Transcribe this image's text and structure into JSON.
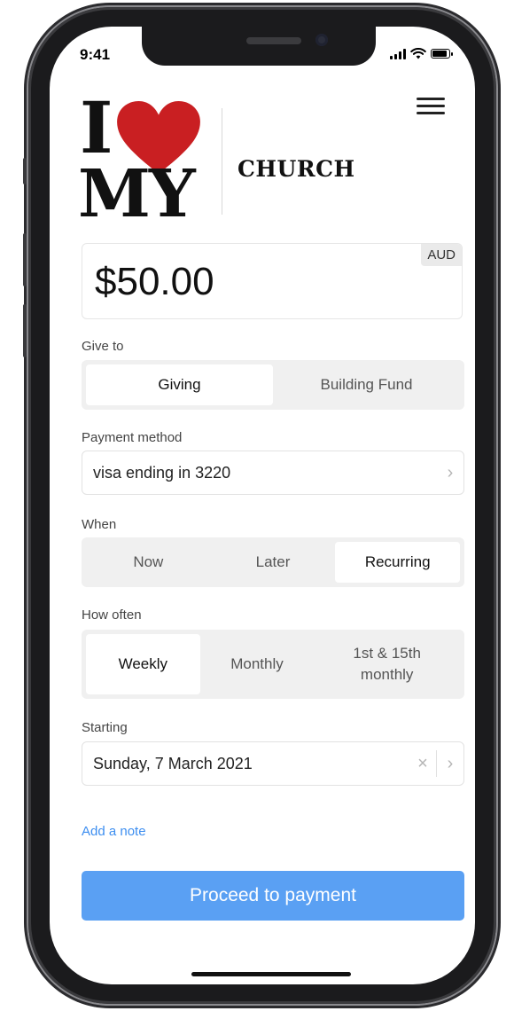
{
  "status_bar": {
    "time": "9:41"
  },
  "logo": {
    "line1": "I",
    "line2": "MY",
    "heart_color": "#c91f22"
  },
  "brand": {
    "name": "CHURCH"
  },
  "amount": {
    "value": "$50.00",
    "currency": "AUD"
  },
  "give_to": {
    "label": "Give to",
    "options": [
      "Giving",
      "Building Fund"
    ],
    "selected": "Giving"
  },
  "payment_method": {
    "label": "Payment method",
    "value": "visa ending in 3220"
  },
  "when": {
    "label": "When",
    "options": [
      "Now",
      "Later",
      "Recurring"
    ],
    "selected": "Recurring"
  },
  "how_often": {
    "label": "How often",
    "options": [
      "Weekly",
      "Monthly",
      "1st & 15th monthly"
    ],
    "selected": "Weekly"
  },
  "starting": {
    "label": "Starting",
    "value": "Sunday, 7 March 2021"
  },
  "add_note": {
    "label": "Add a note"
  },
  "proceed": {
    "label": "Proceed to payment"
  },
  "colors": {
    "accent": "#5aa0f3",
    "link": "#3d8ef0",
    "heart": "#c91f22"
  },
  "icons": {
    "menu": "hamburger-icon",
    "chevron": "chevron-right-icon",
    "clear": "close-icon",
    "signal": "cellular-signal-icon",
    "wifi": "wifi-icon",
    "battery": "battery-icon"
  }
}
